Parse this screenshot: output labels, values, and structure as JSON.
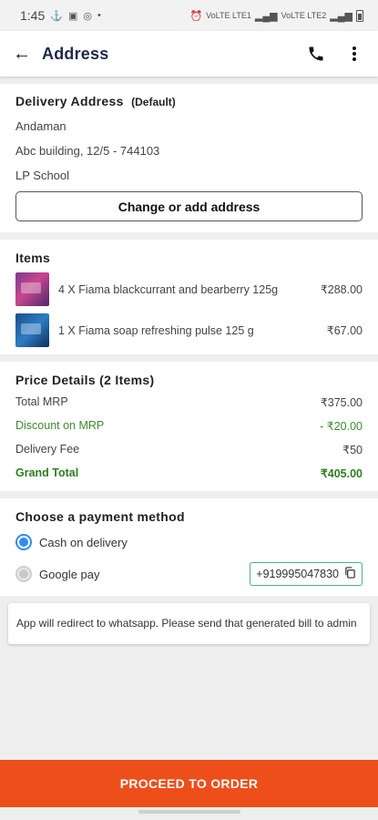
{
  "status_bar": {
    "time": "1:45",
    "net_label_1": "VoLTE LTE1",
    "net_label_2": "VoLTE LTE2"
  },
  "header": {
    "title": "Address"
  },
  "address": {
    "title": "Delivery Address",
    "default_tag": "(Default)",
    "line1": "Andaman",
    "line2": "Abc building, 12/5 - 744103",
    "line3": "LP School",
    "change_button": "Change or add address"
  },
  "items": {
    "title": "Items",
    "list": [
      {
        "name": "4 X Fiama blackcurrant and bearberry 125g",
        "price": "₹288.00"
      },
      {
        "name": "1 X Fiama soap refreshing pulse 125 g",
        "price": "₹67.00"
      }
    ]
  },
  "price": {
    "title": "Price Details (2 Items)",
    "total_mrp_label": "Total MRP",
    "total_mrp_value": "₹375.00",
    "discount_label": "Discount on MRP",
    "discount_value": "- ₹20.00",
    "delivery_label": "Delivery Fee",
    "delivery_value": "₹50",
    "grand_label": "Grand Total",
    "grand_value": "₹405.00"
  },
  "payment": {
    "title": "Choose a payment method",
    "cod_label": "Cash on delivery",
    "gpay_label": "Google pay",
    "gpay_number": "+919995047830"
  },
  "note": "App will redirect to whatsapp. Please send that generated bill to admin",
  "proceed_button": "PROCEED TO ORDER",
  "colors": {
    "accent": "#ee4e1a",
    "radio_selected": "#2f8cf0",
    "grand_total": "#2e7d20",
    "title": "#1f2a4a"
  }
}
